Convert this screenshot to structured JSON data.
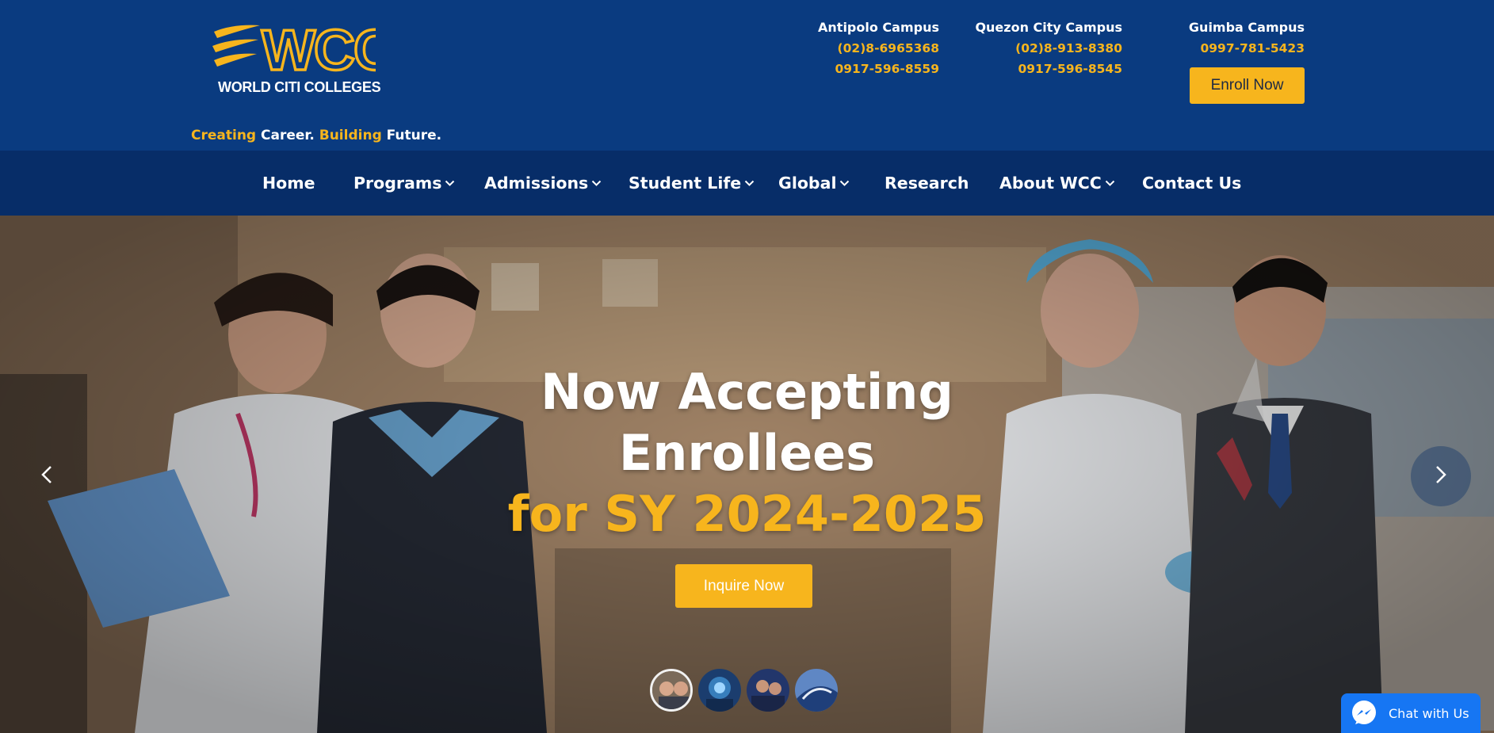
{
  "header": {
    "logo_text": "WCC",
    "logo_subtext": "WORLD CITI COLLEGES",
    "tagline": {
      "w1": "Creating",
      "w2": "Career.",
      "w3": "Building",
      "w4": "Future."
    },
    "campuses": [
      {
        "name": "Antipolo Campus",
        "phones": [
          "(02)8-6965368",
          "0917-596-8559"
        ]
      },
      {
        "name": "Quezon City Campus",
        "phones": [
          "(02)8-913-8380",
          "0917-596-8545"
        ]
      },
      {
        "name": "Guimba Campus",
        "phones": [
          "0997-781-5423"
        ]
      }
    ],
    "enroll_label": "Enroll Now"
  },
  "nav": {
    "items": [
      {
        "label": "Home",
        "dropdown": false
      },
      {
        "label": "Programs",
        "dropdown": true
      },
      {
        "label": "Admissions",
        "dropdown": true
      },
      {
        "label": "Student Life",
        "dropdown": true
      },
      {
        "label": "Global",
        "dropdown": true
      },
      {
        "label": "Research",
        "dropdown": false
      },
      {
        "label": "About WCC",
        "dropdown": true
      },
      {
        "label": "Contact Us",
        "dropdown": false
      }
    ]
  },
  "hero": {
    "line1": "Now Accepting",
    "line2": "Enrollees",
    "line3": "for SY 2024-2025",
    "cta_label": "Inquire Now",
    "prev_icon": "chevron-left-icon",
    "next_icon": "chevron-right-icon",
    "slides_count": 4,
    "active_slide": 1
  },
  "chat": {
    "label": "Chat with Us",
    "icon": "messenger-icon"
  },
  "colors": {
    "header_bg": "#0a3b80",
    "nav_bg": "#072d68",
    "accent": "#f7b51d",
    "chat_blue": "#1676f3"
  }
}
